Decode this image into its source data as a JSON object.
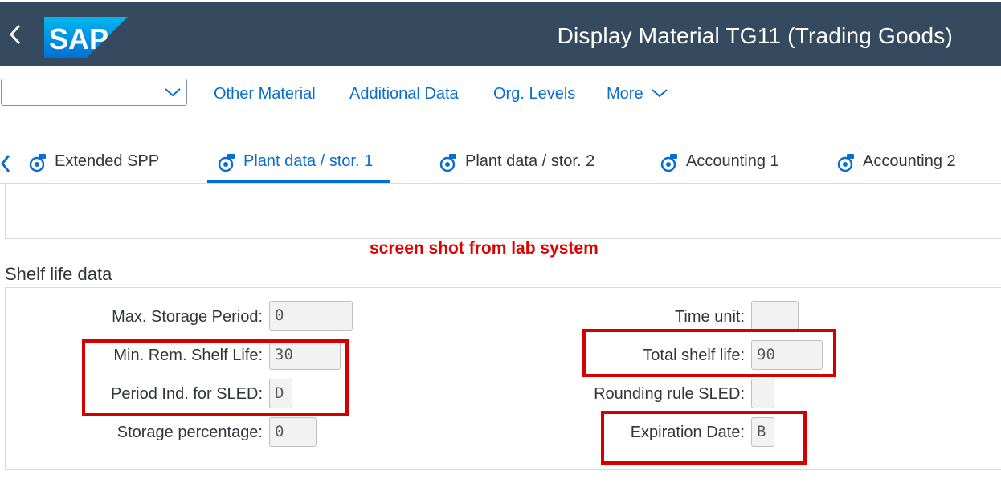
{
  "shell": {
    "logo": "SAP",
    "title": "Display Material TG11 (Trading Goods)"
  },
  "toolbar": {
    "select_value": "",
    "links": [
      "Other Material",
      "Additional Data",
      "Org. Levels",
      "More"
    ]
  },
  "tabs": [
    {
      "label": "Extended SPP",
      "active": false
    },
    {
      "label": "Plant data / stor. 1",
      "active": true
    },
    {
      "label": "Plant data / stor. 2",
      "active": false
    },
    {
      "label": "Accounting 1",
      "active": false
    },
    {
      "label": "Accounting 2",
      "active": false
    }
  ],
  "annotation": "screen shot from lab system",
  "section": {
    "title": "Shelf life data",
    "fields": {
      "max_storage_period": {
        "label": "Max. Storage Period:",
        "value": "0"
      },
      "min_rem_shelf_life": {
        "label": "Min. Rem. Shelf Life:",
        "value": "30"
      },
      "period_ind_sled": {
        "label": "Period Ind. for SLED:",
        "value": "D"
      },
      "storage_percentage": {
        "label": "Storage percentage:",
        "value": "0"
      },
      "time_unit": {
        "label": "Time unit:",
        "value": ""
      },
      "total_shelf_life": {
        "label": "Total shelf life:",
        "value": "90"
      },
      "rounding_rule_sled": {
        "label": "Rounding rule SLED:",
        "value": ""
      },
      "expiration_date": {
        "label": "Expiration Date:",
        "value": "B"
      }
    }
  },
  "colors": {
    "shell_bg": "#354a5f",
    "link": "#0a6ed1",
    "highlight_red": "#d40000",
    "annotation_red": "#e00000"
  },
  "icons": [
    "back-chevron-icon",
    "dropdown-chevron-icon",
    "more-chevron-icon",
    "tab-scroll-left-icon",
    "tab-object-icon"
  ]
}
